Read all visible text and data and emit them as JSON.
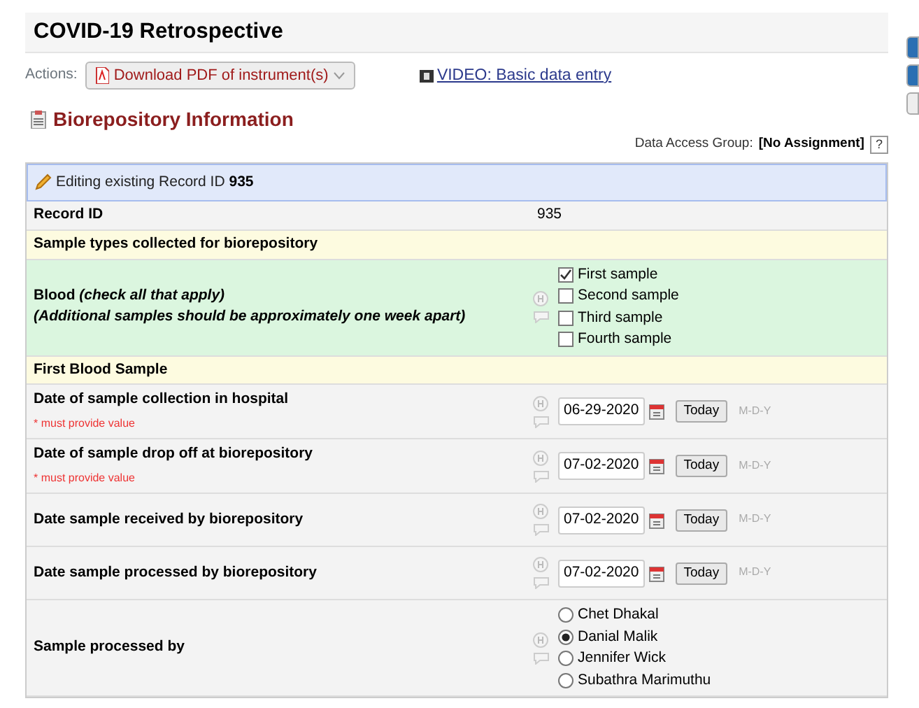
{
  "title": "COVID-19 Retrospective",
  "actions_label": "Actions:",
  "download_button": "Download PDF of instrument(s)",
  "video_link": "VIDEO: Basic data entry",
  "section_title": "Biorepository Information",
  "data_access_group": {
    "label": "Data Access Group:",
    "value": "[No Assignment]",
    "help": "?"
  },
  "editing_banner": "Editing existing Record ID **935**",
  "rows": [
    {
      "kind": "value",
      "label": "Record ID",
      "value": "935"
    },
    {
      "kind": "header",
      "label": "Sample types collected for biorepository"
    },
    {
      "kind": "checkbox",
      "label": "Blood *(check all that apply)*",
      "note": "(Additional samples should be approximately one week apart)",
      "options": [
        {
          "label": "First sample",
          "checked": true
        },
        {
          "label": "Second sample",
          "checked": false
        },
        {
          "label": "Third sample",
          "checked": false
        },
        {
          "label": "Fourth sample",
          "checked": false
        }
      ]
    },
    {
      "kind": "header",
      "label": "First Blood Sample"
    },
    {
      "kind": "date",
      "label": "Date of sample collection in hospital",
      "required": "* must provide value",
      "value": "06-29-2020",
      "button": "Today",
      "format": "M-D-Y"
    },
    {
      "kind": "date",
      "label": "Date of sample drop off at biorepository",
      "required": "* must provide value",
      "value": "07-02-2020",
      "button": "Today",
      "format": "M-D-Y"
    },
    {
      "kind": "date",
      "label": "Date sample received by biorepository",
      "value": "07-02-2020",
      "button": "Today",
      "format": "M-D-Y"
    },
    {
      "kind": "date",
      "label": "Date sample processed by biorepository",
      "value": "07-02-2020",
      "button": "Today",
      "format": "M-D-Y"
    },
    {
      "kind": "radio",
      "label": "Sample processed by",
      "options": [
        {
          "label": "Chet Dhakal",
          "selected": false
        },
        {
          "label": "Danial Malik",
          "selected": true
        },
        {
          "label": "Jennifer Wick",
          "selected": false
        },
        {
          "label": "Subathra Marimuthu",
          "selected": false
        }
      ]
    }
  ]
}
